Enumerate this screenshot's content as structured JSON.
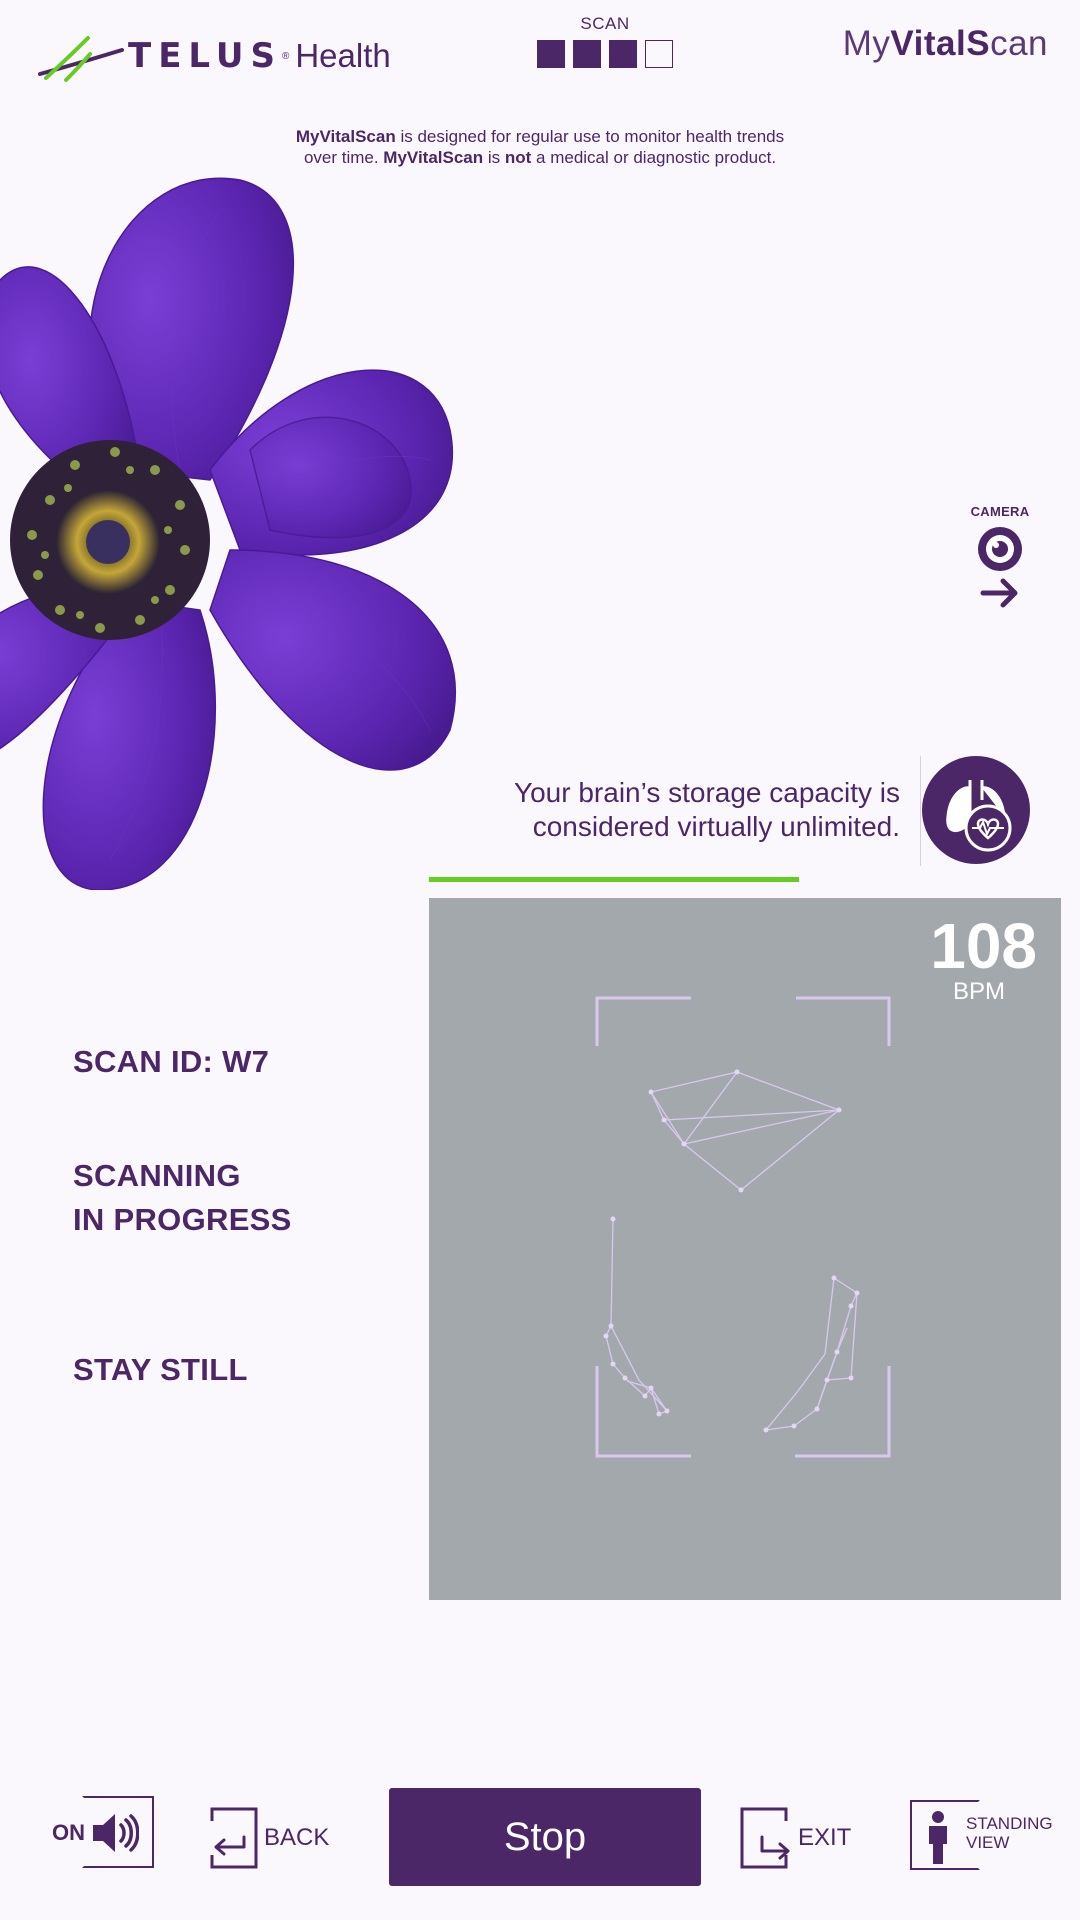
{
  "header": {
    "brand": {
      "wordmark": "TELUS",
      "registered": "®",
      "suffix": "Health"
    },
    "scan_progress": {
      "label": "SCAN",
      "total_steps": 4,
      "completed_steps": 3
    },
    "app_logo": {
      "part1": "My",
      "part2": "VitalS",
      "part3": "can"
    }
  },
  "disclaimer": {
    "line1_bold": "MyVitalScan",
    "line1_rest": " is designed for regular use to monitor health trends",
    "line2_start": "over time. ",
    "line2_bold1": "MyVitalScan",
    "line2_mid": " is ",
    "line2_bold2": "not",
    "line2_end": " a medical or diagnostic product."
  },
  "camera_control": {
    "label": "CAMERA",
    "icon": "camera-icon"
  },
  "fact": {
    "line1": "Your brain’s storage capacity is",
    "line2": "considered virtually unlimited.",
    "icon": "lungs-heart-icon"
  },
  "scan_progress_bar": {
    "fraction": 0.82
  },
  "feed": {
    "bpm_value": "108",
    "bpm_unit": "BPM"
  },
  "status": {
    "scan_id": "SCAN ID: W7",
    "scanning_line1": "SCANNING",
    "scanning_line2": "IN PROGRESS",
    "instruction": "STAY STILL"
  },
  "bottom_bar": {
    "sound": {
      "state": "ON",
      "icon": "speaker-icon"
    },
    "back": {
      "label": "BACK",
      "icon": "back-arrow-icon"
    },
    "stop": {
      "label": "Stop"
    },
    "exit": {
      "label": "EXIT",
      "icon": "exit-icon"
    },
    "standing_view": {
      "line1": "STANDING",
      "line2": "VIEW",
      "icon": "person-icon"
    }
  },
  "colors": {
    "brand_purple": "#4b2768",
    "accent_green": "#66cc1f",
    "background": "#fbf8fd",
    "feed_gray": "#a3a8ad",
    "tracking_lines": "#d9c8ee"
  }
}
